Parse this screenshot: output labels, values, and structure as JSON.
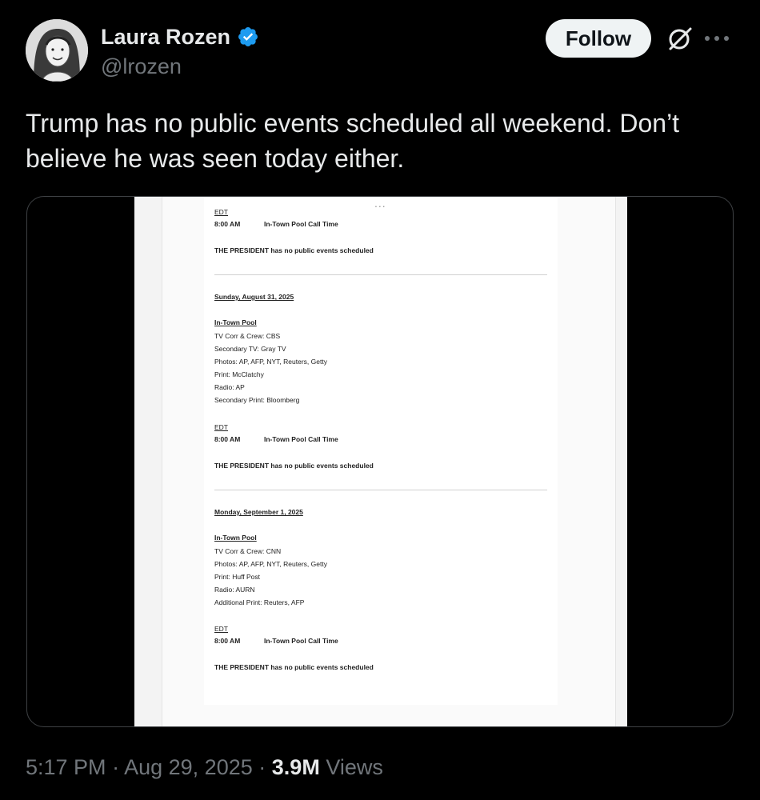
{
  "author": {
    "display_name": "Laura Rozen",
    "handle": "@lrozen",
    "verified": true,
    "avatar_icon": "avatar-illustration"
  },
  "actions": {
    "follow_label": "Follow",
    "grok_icon": "grok-icon",
    "more_icon": "more-options-icon"
  },
  "tweet": {
    "text": "Trump has no public events scheduled all weekend. Don’t believe he was seen today either."
  },
  "media": {
    "dots": "...",
    "blocks": [
      {
        "edt": "EDT",
        "time": "8:00 AM",
        "call": "In-Town Pool Call Time",
        "statement": "THE PRESIDENT has no public events scheduled"
      },
      {
        "date": "Sunday, August 31, 2025",
        "pool_heading": "In-Town Pool",
        "pool_lines": [
          "TV Corr & Crew: CBS",
          "Secondary TV: Gray TV",
          "Photos: AP, AFP, NYT, Reuters, Getty",
          "Print: McClatchy",
          "Radio: AP",
          "Secondary Print: Bloomberg"
        ],
        "edt": "EDT",
        "time": "8:00 AM",
        "call": "In-Town Pool Call Time",
        "statement": "THE PRESIDENT has no public events scheduled"
      },
      {
        "date": "Monday, September 1, 2025",
        "pool_heading": "In-Town Pool",
        "pool_lines": [
          "TV Corr & Crew: CNN",
          "Photos: AP, AFP, NYT, Reuters, Getty",
          "Print: Huff Post",
          "Radio: AURN",
          "Additional Print: Reuters, AFP"
        ],
        "edt": "EDT",
        "time": "8:00 AM",
        "call": "In-Town Pool Call Time",
        "statement": "THE PRESIDENT has no public events scheduled"
      }
    ]
  },
  "meta": {
    "time": "5:17 PM",
    "separator": "·",
    "date": "Aug 29, 2025",
    "views_count": "3.9M",
    "views_label": "Views"
  },
  "colors": {
    "background": "#000000",
    "text": "#e7e9ea",
    "muted": "#71767b",
    "verified": "#1d9bf0"
  }
}
